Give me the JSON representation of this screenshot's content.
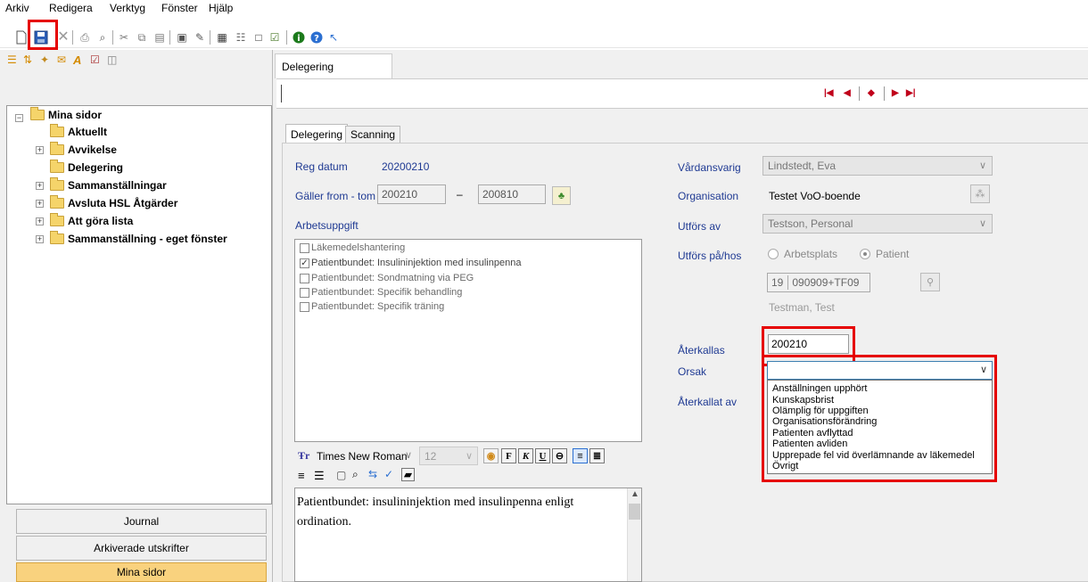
{
  "menu": [
    "Arkiv",
    "Redigera",
    "Verktyg",
    "Fönster",
    "Hjälp"
  ],
  "toolbar_icons": [
    "new-document-icon",
    "save-icon",
    "delete-icon",
    "print-icon",
    "find-icon",
    "cut-icon",
    "copy-icon",
    "paste-icon",
    "print-preview-icon",
    "edit-icon",
    "sign-icon",
    "register-icon",
    "document-icon",
    "preview-icon",
    "info-icon",
    "help-icon",
    "whats-this-icon"
  ],
  "outer_tab": "Delegering",
  "nav_buttons": [
    "first-record",
    "previous-record",
    "current-record",
    "next-record",
    "last-record"
  ],
  "tree": {
    "root": "Mina sidor",
    "items": [
      "Aktuellt",
      "Avvikelse",
      "Delegering",
      "Sammanställningar",
      "Avsluta HSL Åtgärder",
      "Att göra lista",
      "Sammanställning - eget fönster"
    ]
  },
  "left_nav": [
    "Journal",
    "Arkiverade utskrifter",
    "Mina sidor"
  ],
  "subtabs": [
    "Delegering",
    "Scanning"
  ],
  "form": {
    "reg_datum_label": "Reg datum",
    "reg_datum_value": "20200210",
    "galler_label": "Gäller from - tom",
    "galler_from": "200210",
    "galler_dash": "–",
    "galler_tom": "200810",
    "arbetsuppgift_label": "Arbetsuppgift",
    "tasks": [
      {
        "label": "Läkemedelshantering",
        "checked": false
      },
      {
        "label": "Patientbundet: Insulininjektion med insulinpenna",
        "checked": true
      },
      {
        "label": "Patientbundet: Sondmatning via PEG",
        "checked": false
      },
      {
        "label": "Patientbundet: Specifik behandling",
        "checked": false
      },
      {
        "label": "Patientbundet: Specifik träning",
        "checked": false
      }
    ],
    "vardansvarig_label": "Vårdansvarig",
    "vardansvarig_value": "Lindstedt, Eva",
    "organisation_label": "Organisation",
    "organisation_value": "Testet VoO-boende",
    "utfors_av_label": "Utförs av",
    "utfors_av_value": "Testson, Personal",
    "utfors_pa_label": "Utförs på/hos",
    "radio_arbetsplats": "Arbetsplats",
    "radio_patient": "Patient",
    "pnr_century": "19",
    "pnr_value": "090909+TF09",
    "patient_name": "Testman, Test",
    "aterkallas_label": "Återkallas",
    "aterkallas_value": "200210",
    "orsak_label": "Orsak",
    "aterkallat_av_label": "Återkallat av",
    "orsak_options": [
      "Anställningen upphört",
      "Kunskapsbrist",
      "Olämplig för uppgiften",
      "Organisationsförändring",
      "Patienten avflyttad",
      "Patienten avliden",
      "Upprepade fel vid överlämnande av läkemedel",
      "Övrigt"
    ]
  },
  "editor": {
    "font_name": "Times New Roman",
    "font_size": "12",
    "bold": "F",
    "italic": "K",
    "underline": "U",
    "text": "Patientbundet: insulininjektion med insulinpenna enligt ordination."
  },
  "colors": {
    "highlight_red": "#e60000",
    "label_blue": "#1f3a93",
    "active_nav": "#f9d27e",
    "nav_arrow": "#c0001a"
  }
}
